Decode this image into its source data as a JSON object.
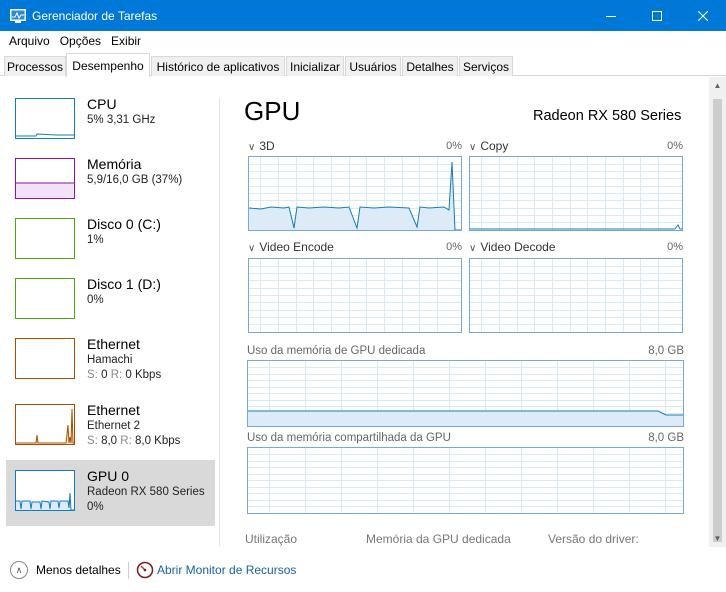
{
  "window": {
    "title": "Gerenciador de Tarefas",
    "icon": "task-manager-icon"
  },
  "menu": [
    "Arquivo",
    "Opções",
    "Exibir"
  ],
  "tabs": [
    "Processos",
    "Desempenho",
    "Histórico de aplicativos",
    "Inicializar",
    "Usuários",
    "Detalhes",
    "Serviços"
  ],
  "sidebar": [
    {
      "name": "CPU",
      "line1": "5% 3,31 GHz",
      "color": "#117dbb"
    },
    {
      "name": "Memória",
      "line1": "5,9/16,0 GB (37%)",
      "color": "#8b12ae"
    },
    {
      "name": "Disco 0 (C:)",
      "line1": "1%",
      "color": "#4da60c"
    },
    {
      "name": "Disco 1 (D:)",
      "line1": "0%",
      "color": "#4da60c"
    },
    {
      "name": "Ethernet",
      "line1": "Hamachi",
      "send_label": "S:",
      "send": "0",
      "recv_label": "R:",
      "recv": "0 Kbps",
      "color": "#a74f01"
    },
    {
      "name": "Ethernet",
      "line1": "Ethernet 2",
      "send_label": "S:",
      "send": "8,0",
      "recv_label": "R:",
      "recv": "8,0 Kbps",
      "color": "#a74f01"
    },
    {
      "name": "GPU 0",
      "line1": "Radeon RX 580 Series",
      "line2": "0%",
      "color": "#117dbb",
      "selected": true
    }
  ],
  "main": {
    "title": "GPU",
    "model": "Radeon RX 580 Series",
    "engines": [
      {
        "name": "3D",
        "pct": "0%"
      },
      {
        "name": "Copy",
        "pct": "0%"
      },
      {
        "name": "Video Encode",
        "pct": "0%"
      },
      {
        "name": "Video Decode",
        "pct": "0%"
      }
    ],
    "dedicated": {
      "label": "Uso da memória de GPU dedicada",
      "max": "8,0 GB"
    },
    "shared": {
      "label": "Uso da memória compartilhada da GPU",
      "max": "8,0 GB"
    },
    "stats": [
      "Utilização",
      "Memória da GPU dedicada",
      "Versão do driver:"
    ]
  },
  "footer": {
    "less_details": "Menos detalhes",
    "open_monitor": "Abrir Monitor de Recursos"
  },
  "colors": {
    "accent": "#0078d7",
    "gpu_line": "#117dbb",
    "link": "#1a5fa8"
  }
}
